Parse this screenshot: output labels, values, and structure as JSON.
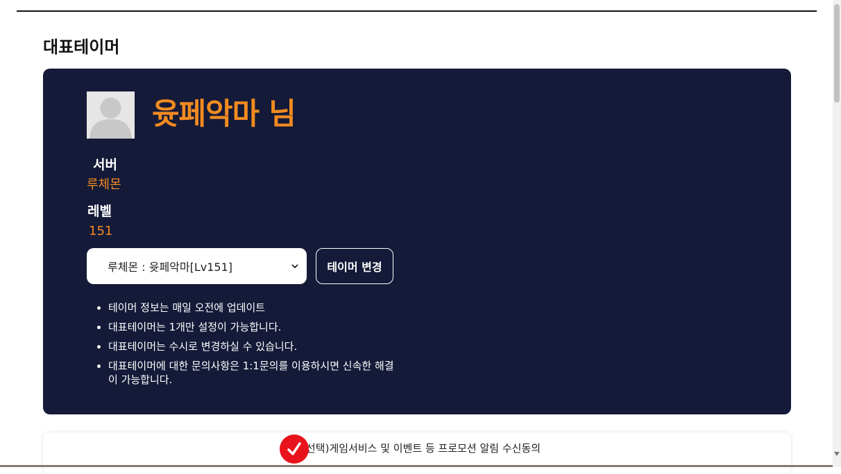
{
  "section": {
    "title": "대표테이머"
  },
  "profile": {
    "name": "윳페악마 님",
    "server_label": "서버",
    "server_value": "루체몬",
    "level_label": "레벨",
    "level_value": "151"
  },
  "tamer_select": {
    "selected": "루체몬 : 윳페악마[Lv151]"
  },
  "change_button": {
    "label": "테이머 변경"
  },
  "notes": [
    "테이머 정보는 매일 오전에 업데이트",
    "대표테이머는 1개만 설정이 가능합니다.",
    "대표테이머는 수시로 변경하실 수 있습니다.",
    "대표테이머에 대한 문의사항은 1:1문의를 이용하시면 신속한 해결이 가능합니다."
  ],
  "consent": {
    "label": "선택)게임서비스 및 이벤트 등 프로모션 알림 수신동의"
  },
  "colors": {
    "card_bg": "#141a38",
    "accent": "#f28b20",
    "check": "#e8131c"
  },
  "icons": {
    "avatar": "default-avatar-icon",
    "select": "chevron-down-icon",
    "check": "checkmark-icon"
  }
}
